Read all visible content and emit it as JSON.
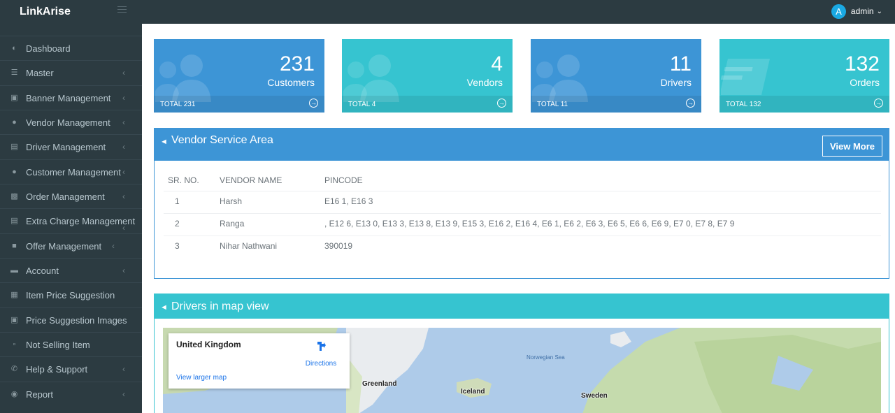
{
  "header": {
    "brand": "LinkArise",
    "avatar_letter": "A",
    "user_name": "admin"
  },
  "sidebar": {
    "items": [
      {
        "label": "Dashboard",
        "icon": "dashboard-icon"
      },
      {
        "label": "Master",
        "icon": "list-icon"
      },
      {
        "label": "Banner Management",
        "icon": "image-icon"
      },
      {
        "label": "Vendor Management",
        "icon": "user-icon"
      },
      {
        "label": "Driver Management",
        "icon": "inbox-icon"
      },
      {
        "label": "Customer Management",
        "icon": "user-icon"
      },
      {
        "label": "Order Management",
        "icon": "book-icon"
      },
      {
        "label": "Extra Charge Management",
        "icon": "list-alt-icon"
      },
      {
        "label": "Offer Management",
        "icon": "gift-icon"
      },
      {
        "label": "Account",
        "icon": "credit-card-icon"
      },
      {
        "label": "Item Price Suggestion",
        "icon": "grid-icon"
      },
      {
        "label": "Price Suggestion Images",
        "icon": "image-icon"
      },
      {
        "label": "Not Selling Item",
        "icon": "trash-icon"
      },
      {
        "label": "Help & Support",
        "icon": "phone-icon"
      },
      {
        "label": "Report",
        "icon": "info-icon"
      }
    ]
  },
  "stats": [
    {
      "number": "231",
      "label": "Customers",
      "footer": "TOTAL 231",
      "color": "#3d95d6",
      "icon": "users-icon"
    },
    {
      "number": "4",
      "label": "Vendors",
      "footer": "TOTAL 4",
      "color": "#36c4d0",
      "icon": "users-icon"
    },
    {
      "number": "11",
      "label": "Drivers",
      "footer": "TOTAL 11",
      "color": "#3d95d6",
      "icon": "users-icon"
    },
    {
      "number": "132",
      "label": "Orders",
      "footer": "TOTAL 132",
      "color": "#36c4d0",
      "icon": "card-icon"
    }
  ],
  "vendor_panel": {
    "title": "Vendor Service Area",
    "view_more": "View More",
    "columns": [
      "SR. NO.",
      "VENDOR NAME",
      "PINCODE"
    ],
    "rows": [
      [
        "1",
        "Harsh",
        "E16 1, E16 3"
      ],
      [
        "2",
        "Ranga",
        ", E12 6, E13 0, E13 3, E13 8, E13 9, E15 3, E16 2, E16 4, E6 1, E6 2, E6 3, E6 5, E6 6, E6 9, E7 0, E7 8, E7 9"
      ],
      [
        "3",
        "Nihar Nathwani",
        "390019"
      ]
    ]
  },
  "map_panel": {
    "title": "Drivers in map view",
    "card_title": "United Kingdom",
    "directions": "Directions",
    "larger_map": "View larger map",
    "places": [
      "Greenland",
      "Iceland",
      "Sweden",
      "Norwegian Sea"
    ]
  }
}
